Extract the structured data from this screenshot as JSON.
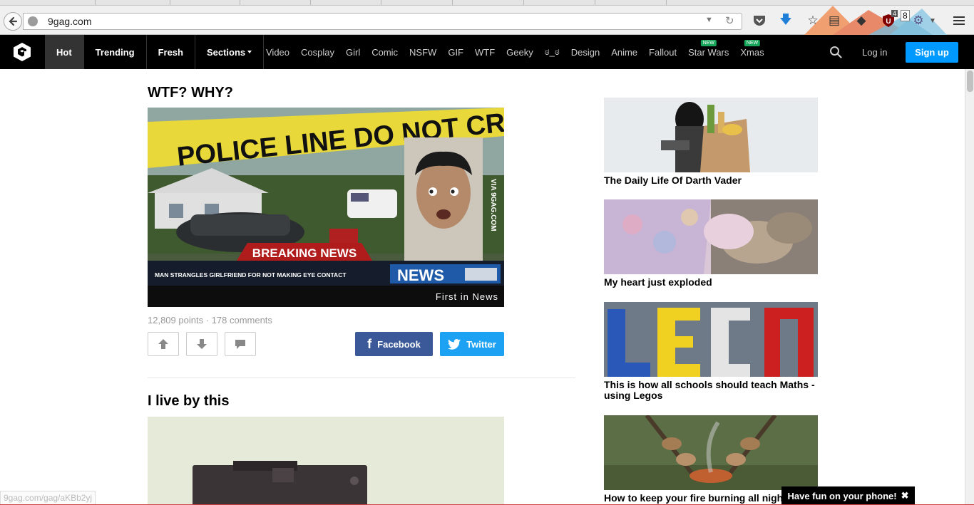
{
  "browser": {
    "url": "9gag.com",
    "downloads_badge": "4",
    "ublock_count": "8"
  },
  "header": {
    "nav": [
      "Hot",
      "Trending",
      "Fresh",
      "Sections"
    ],
    "active_nav": "Hot",
    "sections": [
      {
        "label": "Video",
        "badge": ""
      },
      {
        "label": "Cosplay",
        "badge": ""
      },
      {
        "label": "Girl",
        "badge": ""
      },
      {
        "label": "Comic",
        "badge": ""
      },
      {
        "label": "NSFW",
        "badge": ""
      },
      {
        "label": "GIF",
        "badge": ""
      },
      {
        "label": "WTF",
        "badge": ""
      },
      {
        "label": "Geeky",
        "badge": ""
      },
      {
        "label": "ಠ_ಠ",
        "badge": ""
      },
      {
        "label": "Design",
        "badge": ""
      },
      {
        "label": "Anime",
        "badge": ""
      },
      {
        "label": "Fallout",
        "badge": ""
      },
      {
        "label": "Star Wars",
        "badge": "NEW"
      },
      {
        "label": "Xmas",
        "badge": "NEW"
      }
    ],
    "login_label": "Log in",
    "signup_label": "Sign up"
  },
  "post": {
    "title": "WTF? WHY?",
    "image": {
      "tape_text": "POLICE LINE DO NOT CROSS",
      "watermark": "VIA 9GAG.COM",
      "breaking": "BREAKING NEWS",
      "ticker": "MAN STRANGLES GIRLFRIEND FOR NOT MAKING EYE CONTACT",
      "news_logo": "NEWS",
      "slogan": "First in News"
    },
    "points": "12,809 points",
    "comments": "178 comments",
    "share_facebook": "Facebook",
    "share_twitter": "Twitter"
  },
  "post2": {
    "title": "I live by this"
  },
  "sidebar": {
    "items": [
      {
        "caption": "The Daily Life Of Darth Vader"
      },
      {
        "caption": "My heart just exploded"
      },
      {
        "caption": "This is how all schools should teach Maths - using Legos"
      },
      {
        "caption": "How to keep your fire burning all night"
      }
    ]
  },
  "status_url": "9gag.com/gag/aKBb2yj",
  "app_promo": "Have fun on your phone!",
  "colors": {
    "header_bg": "#000000",
    "signup": "#0099ff",
    "facebook": "#3b5998",
    "twitter": "#1da1f2",
    "new_badge": "#17a65a"
  }
}
